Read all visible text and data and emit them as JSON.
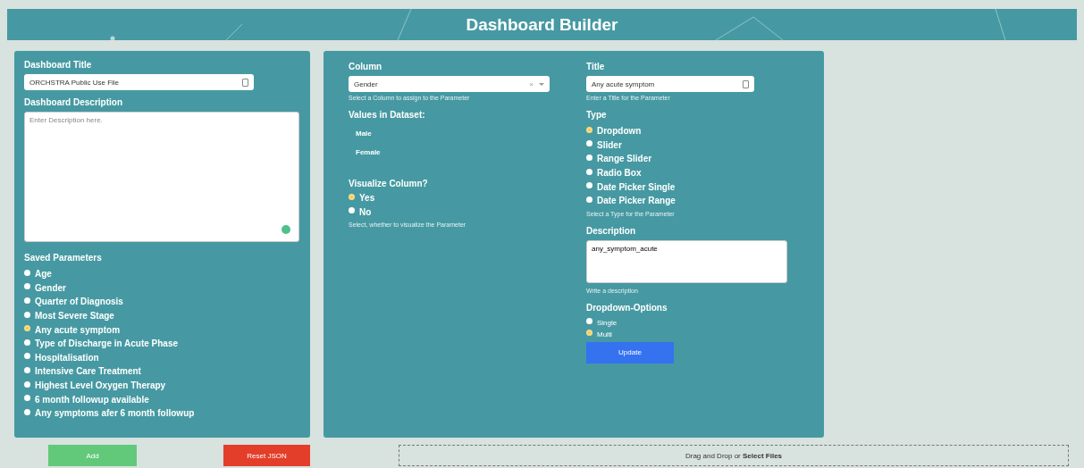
{
  "header": {
    "title": "Dashboard Builder"
  },
  "left": {
    "title_label": "Dashboard Title",
    "title_value": "ORCHSTRA Public Use File",
    "description_label": "Dashboard Description",
    "description_placeholder": "Enter Description here.",
    "saved_label": "Saved Parameters",
    "parameters": [
      {
        "label": "Age",
        "selected": false
      },
      {
        "label": "Gender",
        "selected": false
      },
      {
        "label": "Quarter of Diagnosis",
        "selected": false
      },
      {
        "label": "Most Severe Stage",
        "selected": false
      },
      {
        "label": "Any acute symptom",
        "selected": true
      },
      {
        "label": "Type of Discharge in Acute Phase",
        "selected": false
      },
      {
        "label": "Hospitalisation",
        "selected": false
      },
      {
        "label": "Intensive Care Treatment",
        "selected": false
      },
      {
        "label": "Highest Level Oxygen Therapy",
        "selected": false
      },
      {
        "label": "6 month followup available",
        "selected": false
      },
      {
        "label": "Any symptoms afer 6 month followup",
        "selected": false
      }
    ]
  },
  "column": {
    "label": "Column",
    "value": "Gender",
    "clear": "×",
    "help": "Select a Column to assign to the Parameter",
    "values_label": "Values in Dataset:",
    "values": [
      "Male",
      "Female"
    ],
    "visualize_label": "Visualize Column?",
    "visualize_options": [
      {
        "label": "Yes",
        "selected": true
      },
      {
        "label": "No",
        "selected": false
      }
    ],
    "visualize_help": "Select, whether to visualize the Parameter"
  },
  "param": {
    "title_label": "Title",
    "title_value": "Any acute symptom",
    "title_help": "Enter a Title for the Parameter",
    "type_label": "Type",
    "types": [
      {
        "label": "Dropdown",
        "selected": true
      },
      {
        "label": "Slider",
        "selected": false
      },
      {
        "label": "Range Slider",
        "selected": false
      },
      {
        "label": "Radio Box",
        "selected": false
      },
      {
        "label": "Date Picker Single",
        "selected": false
      },
      {
        "label": "Date Picker Range",
        "selected": false
      }
    ],
    "type_help": "Select a Type for the Parameter",
    "description_label": "Description",
    "description_value": "any_symptom_acute",
    "description_help": "Write a description",
    "options_label": "Dropdown-Options",
    "options": [
      {
        "label": "Single",
        "selected": false
      },
      {
        "label": "Multi",
        "selected": true
      }
    ],
    "update_button": "Update"
  },
  "bottom": {
    "add_button": "Add",
    "reset_button": "Reset JSON",
    "dropzone": "Drag and Drop or **Select Files**"
  }
}
